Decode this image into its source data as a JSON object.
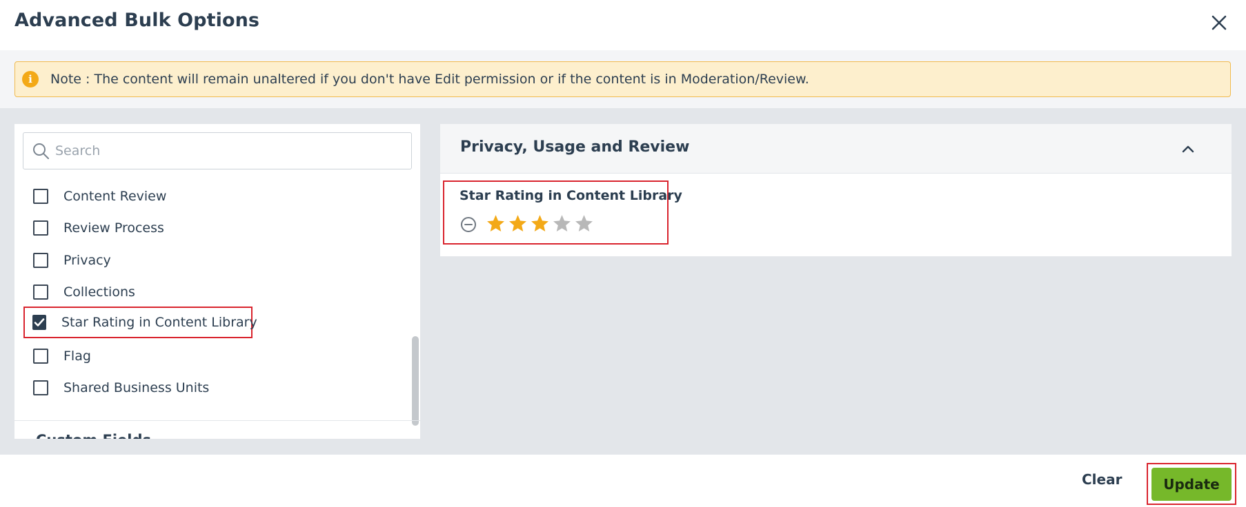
{
  "dialog": {
    "title": "Advanced Bulk Options"
  },
  "note": {
    "text": "Note : The content will remain unaltered if you don't have Edit permission or if the content is in Moderation/Review."
  },
  "options": {
    "search_placeholder": "Search",
    "items": [
      {
        "label": "Content Review",
        "checked": false
      },
      {
        "label": "Review Process",
        "checked": false
      },
      {
        "label": "Privacy",
        "checked": false
      },
      {
        "label": "Collections",
        "checked": false
      },
      {
        "label": "Star Rating in Content Library",
        "checked": true
      },
      {
        "label": "Flag",
        "checked": false
      },
      {
        "label": "Shared Business Units",
        "checked": false
      }
    ],
    "next_section": "Custom Fields"
  },
  "panel": {
    "section_title": "Privacy, Usage and Review",
    "field": {
      "label": "Star Rating in Content Library",
      "rating": 3,
      "max": 5
    }
  },
  "footer": {
    "clear_label": "Clear",
    "update_label": "Update"
  },
  "colors": {
    "accent_green": "#76b82a",
    "star_on": "#f3a917",
    "star_off": "#b8b8b8",
    "highlight": "#d9232d"
  }
}
